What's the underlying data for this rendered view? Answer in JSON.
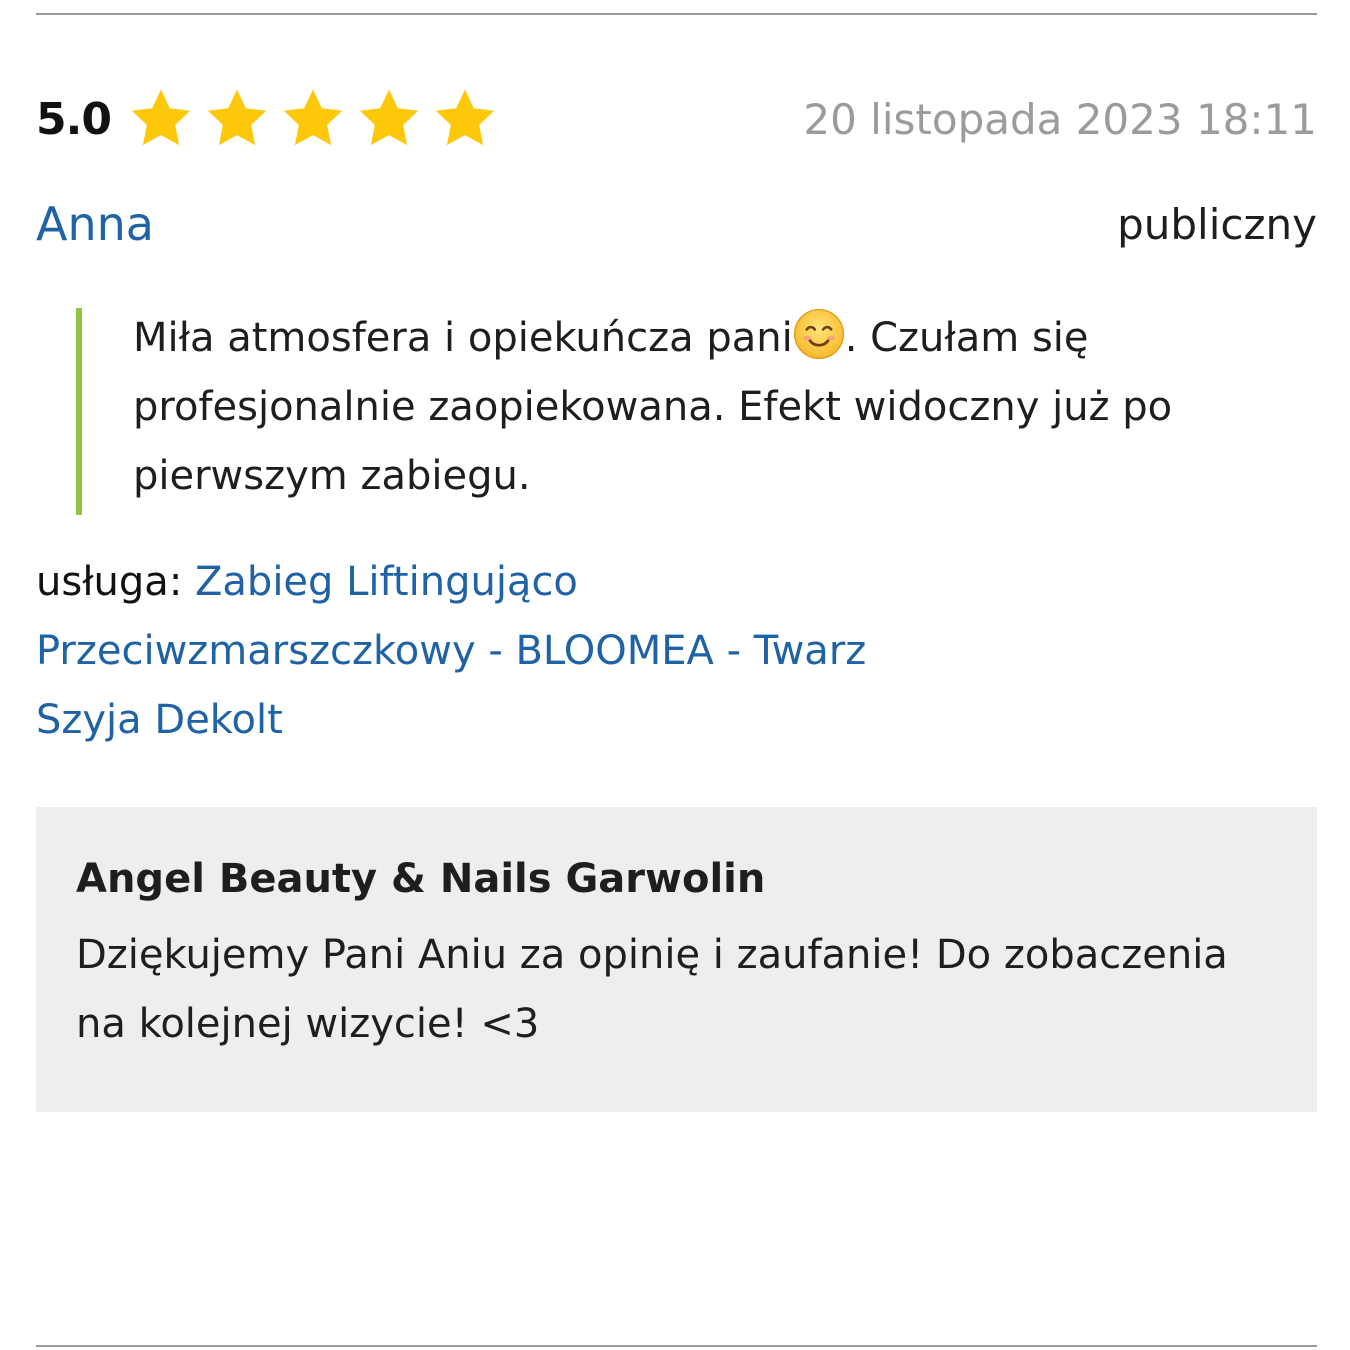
{
  "review": {
    "score": "5.0",
    "rating": 5,
    "rating_max": 5,
    "date": "20 listopada 2023 18:11",
    "author": "Anna",
    "visibility": "publiczny",
    "text_before_emoji": "Miła atmosfera i opiekuńcza pani",
    "emoji_icon": "smiling-face-icon",
    "text_after_emoji": ". Czułam się profesjonalnie zaopiekowana. Efekt widoczny już po pierwszym zabiegu.",
    "service_label": "usługa:",
    "service_name": "Zabieg Liftingująco Przeciwzmarszczkowy - BLOOMEA - Twarz Szyja Dekolt"
  },
  "reply": {
    "business_name": "Angel Beauty & Nails Garwolin",
    "text": "Dziękujemy Pani Aniu za opinię i zaufanie! Do zobaczenia na kolejnej wizycie! <3"
  },
  "colors": {
    "star": "#fdc80a",
    "link": "#1f62a5",
    "date": "#9b9b9b",
    "quote_border": "#8dc63f",
    "reply_background": "#eeeeee"
  }
}
